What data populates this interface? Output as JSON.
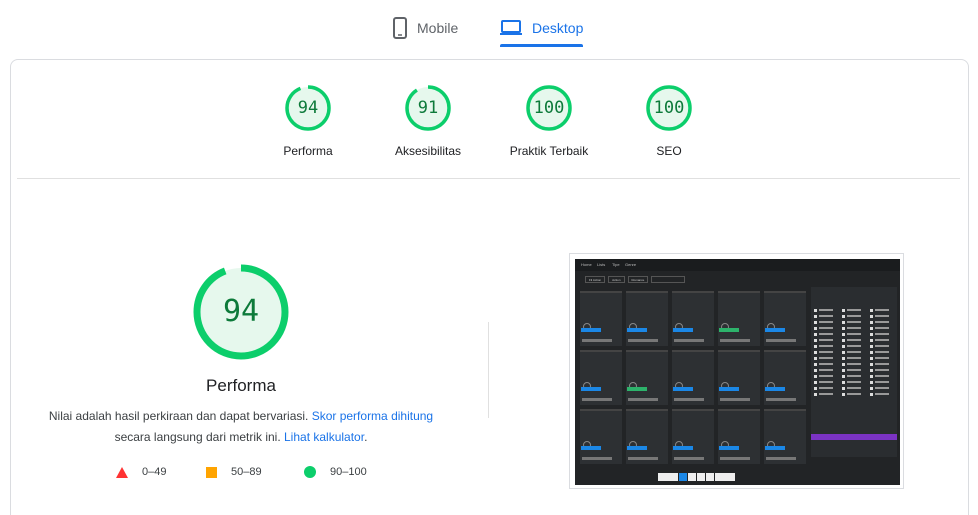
{
  "tabs": {
    "mobile": {
      "label": "Mobile",
      "icon": "smartphone-icon"
    },
    "desktop": {
      "label": "Desktop",
      "icon": "laptop-icon",
      "active": true
    }
  },
  "colors": {
    "accent": "#1a73e8",
    "pass": "#0cce6b",
    "pass_text": "#0d7a3a",
    "average": "#ffa400",
    "fail": "#ff3333"
  },
  "categories": [
    {
      "score": "94",
      "label": "Performa",
      "value": 94
    },
    {
      "score": "91",
      "label": "Aksesibilitas",
      "value": 91
    },
    {
      "score": "100",
      "label": "Praktik Terbaik",
      "value": 100
    },
    {
      "score": "100",
      "label": "SEO",
      "value": 100
    }
  ],
  "performance": {
    "score": "94",
    "value": 94,
    "title": "Performa",
    "desc_prefix": "Nilai adalah hasil perkiraan dan dapat bervariasi. ",
    "desc_link1": "Skor performa dihitung",
    "desc_mid": " secara langsung dari metrik ini. ",
    "desc_link2": "Lihat kalkulator",
    "desc_suffix": "."
  },
  "legend": [
    {
      "range": "0–49",
      "shape": "triangle-icon"
    },
    {
      "range": "50–89",
      "shape": "square-icon"
    },
    {
      "range": "90–100",
      "shape": "circle-icon"
    }
  ],
  "screenshot": {
    "nav": [
      "Home",
      "Lists",
      "Tipe",
      "Genre"
    ],
    "filters": [
      "Fil Action",
      "Action",
      "Romance"
    ]
  }
}
